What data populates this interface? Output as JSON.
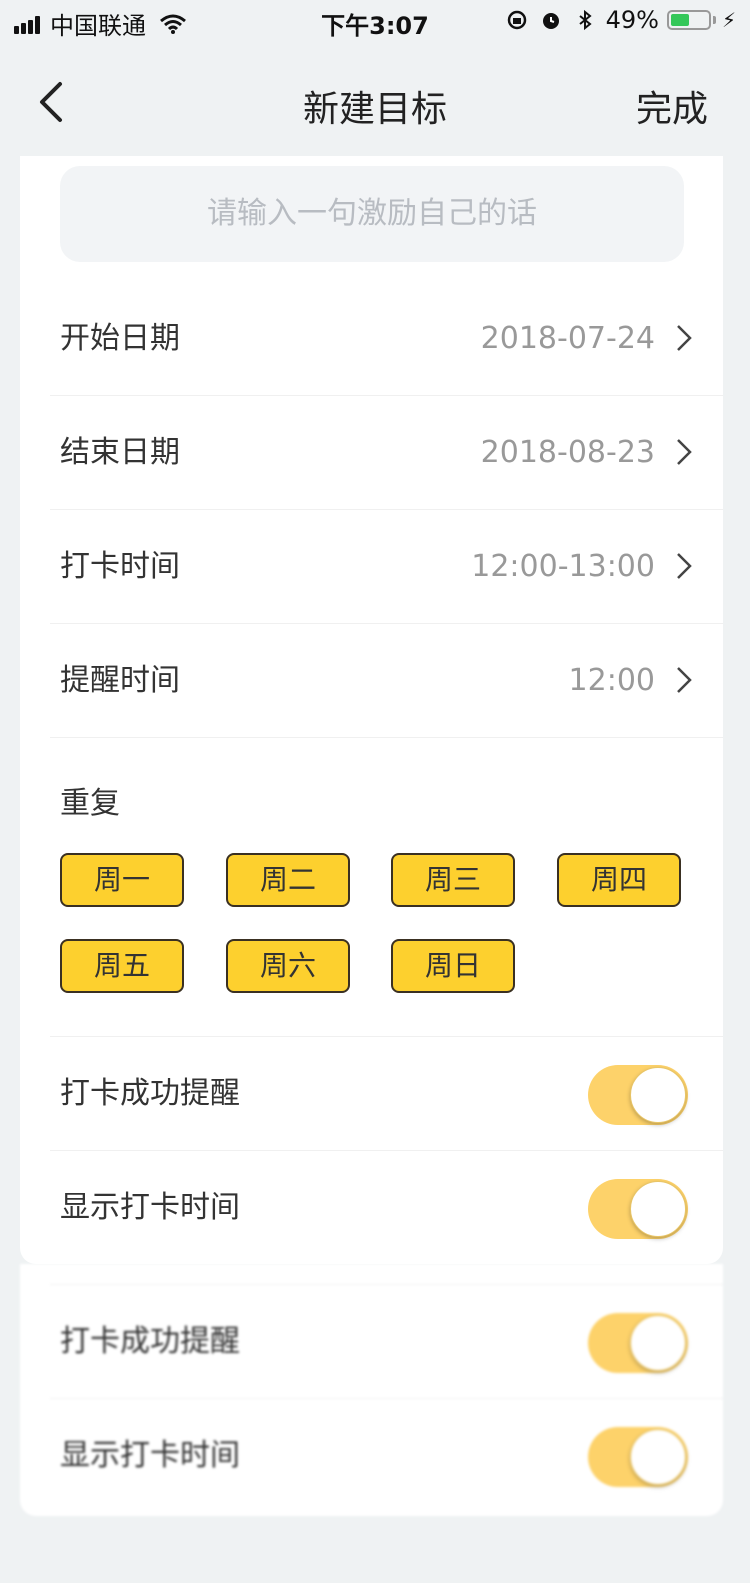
{
  "status_bar": {
    "carrier": "中国联通",
    "time": "下午3:07",
    "battery": "49%",
    "battery_level": 0.49,
    "icons": [
      "signal-icon",
      "wifi-icon",
      "rotation-lock-icon",
      "alarm-icon",
      "bluetooth-icon",
      "battery-icon",
      "charging-icon"
    ]
  },
  "nav": {
    "title": "新建目标",
    "done": "完成",
    "back_icon": "chevron-left-icon"
  },
  "motto": {
    "placeholder": "请输入一句激励自己的话"
  },
  "rows": [
    {
      "label": "开始日期",
      "value": "2018-07-24"
    },
    {
      "label": "结束日期",
      "value": "2018-08-23"
    },
    {
      "label": "打卡时间",
      "value": "12:00-13:00"
    },
    {
      "label": "提醒时间",
      "value": "12:00"
    }
  ],
  "repeat": {
    "label": "重复",
    "days": [
      "周一",
      "周二",
      "周三",
      "周四",
      "周五",
      "周六",
      "周日"
    ]
  },
  "toggles": [
    {
      "label": "打卡成功提醒",
      "on": true
    },
    {
      "label": "显示打卡时间",
      "on": true
    }
  ],
  "toggles_echo": [
    {
      "label": "打卡成功提醒",
      "on": true
    },
    {
      "label": "显示打卡时间",
      "on": true
    }
  ],
  "colors": {
    "accent": "#fdd02e",
    "toggle_on": "#fdd26a",
    "background": "#eff2f3"
  }
}
